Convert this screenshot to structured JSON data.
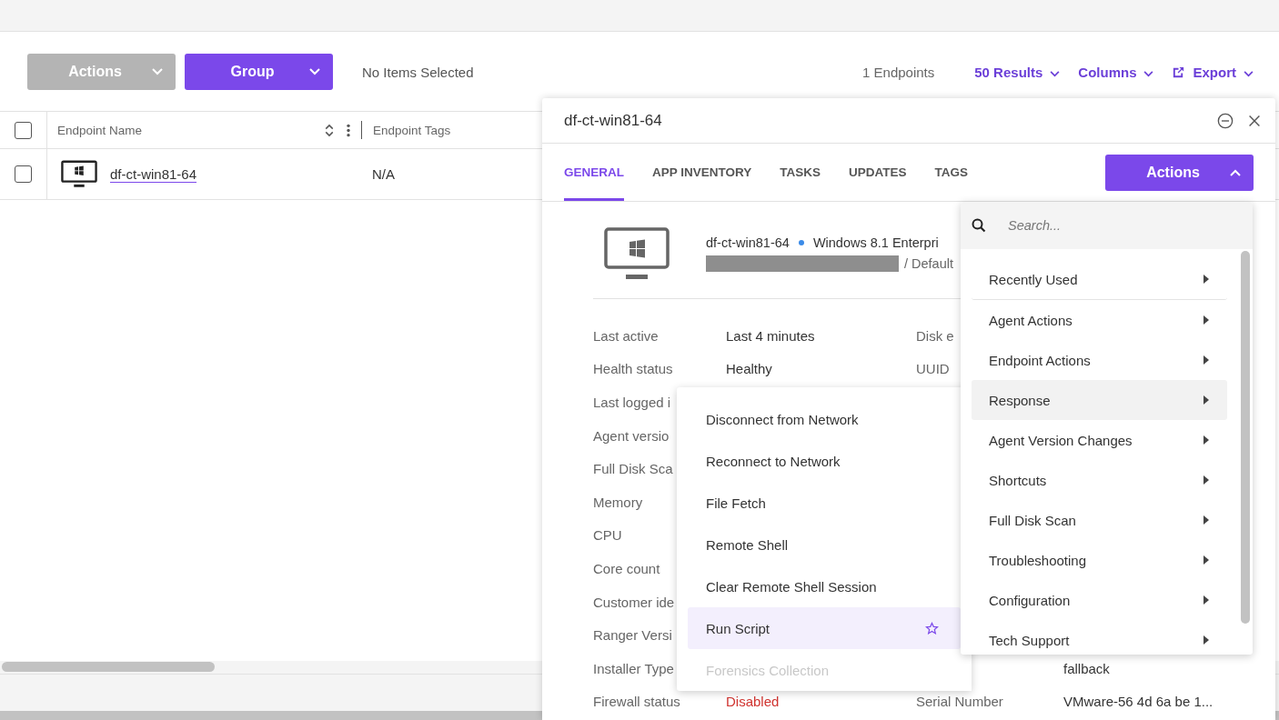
{
  "toolbar": {
    "actions_button": {
      "label": "Actions",
      "disabled": true
    },
    "group_button": {
      "label": "Group",
      "disabled": false
    },
    "selection_status": "No Items Selected",
    "endpoint_count": "1 Endpoints",
    "results": "50 Results",
    "columns": "Columns",
    "export": "Export"
  },
  "table": {
    "header_checked": false,
    "columns": [
      {
        "label": "Endpoint Name"
      },
      {
        "label": "Endpoint Tags"
      }
    ],
    "rows": [
      {
        "checked": false,
        "name": "df-ct-win81-64",
        "tags": "N/A"
      }
    ]
  },
  "panel": {
    "title": "df-ct-win81-64",
    "tabs": [
      {
        "label": "GENERAL",
        "selected": true
      },
      {
        "label": "APP INVENTORY",
        "selected": false
      },
      {
        "label": "TASKS",
        "selected": false
      },
      {
        "label": "UPDATES",
        "selected": false
      },
      {
        "label": "TAGS",
        "selected": false
      }
    ],
    "actions_button": {
      "label": "Actions",
      "expanded": true
    },
    "summary": {
      "name": "df-ct-win81-64",
      "os": "Windows 8.1 Enterpri",
      "site": "/ Default"
    },
    "details": [
      {
        "label": "Last active",
        "value": "Last 4 minutes",
        "right_label": "Disk e"
      },
      {
        "label": "Health status",
        "value": "Healthy",
        "right_label": "UUID"
      },
      {
        "label": "Last logged i"
      },
      {
        "label": "Agent versio"
      },
      {
        "label": "Full Disk Sca"
      },
      {
        "label": "Memory"
      },
      {
        "label": "CPU"
      },
      {
        "label": "Core count"
      },
      {
        "label": "Customer ide"
      },
      {
        "label": "Ranger Versi"
      },
      {
        "label": "Installer Type",
        "right_value": "fallback"
      },
      {
        "label": "Firewall status",
        "value": "Disabled",
        "color": "#d0332f",
        "right_label": "Serial Number",
        "right_value": "VMware-56 4d 6a be 1..."
      }
    ]
  },
  "actions_menu": {
    "search_placeholder": "Search...",
    "items": [
      {
        "label": "Recently Used",
        "selected": false
      },
      {
        "label": "Agent Actions",
        "selected": false
      },
      {
        "label": "Endpoint Actions",
        "selected": false
      },
      {
        "label": "Response",
        "selected": true
      },
      {
        "label": "Agent Version Changes",
        "selected": false
      },
      {
        "label": "Shortcuts",
        "selected": false
      },
      {
        "label": "Full Disk Scan",
        "selected": false
      },
      {
        "label": "Troubleshooting",
        "selected": false
      },
      {
        "label": "Configuration",
        "selected": false
      },
      {
        "label": "Tech Support",
        "selected": false
      }
    ]
  },
  "submenu": {
    "items": [
      {
        "label": "Disconnect from Network",
        "selected": false,
        "disabled": false,
        "starred": false
      },
      {
        "label": "Reconnect to Network",
        "selected": false,
        "disabled": false,
        "starred": false
      },
      {
        "label": "File Fetch",
        "selected": false,
        "disabled": false,
        "starred": false
      },
      {
        "label": "Remote Shell",
        "selected": false,
        "disabled": false,
        "starred": false
      },
      {
        "label": "Clear Remote Shell Session",
        "selected": false,
        "disabled": false,
        "starred": false
      },
      {
        "label": "Run Script",
        "selected": true,
        "disabled": false,
        "starred": true
      },
      {
        "label": "Forensics Collection",
        "selected": false,
        "disabled": true,
        "starred": false
      }
    ]
  }
}
